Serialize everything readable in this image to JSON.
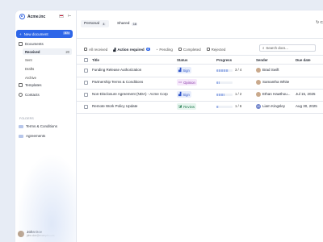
{
  "brand": {
    "name": "Acme.inc"
  },
  "sidebar": {
    "new_document": "New document",
    "new_document_kbd": "⌘N",
    "documents": "Documents",
    "sub": [
      {
        "label": "Received",
        "count": "20"
      },
      {
        "label": "Sent",
        "count": ""
      },
      {
        "label": "Drafts",
        "count": ""
      },
      {
        "label": "Archive",
        "count": ""
      }
    ],
    "templates": "Templates",
    "contacts": "Contacts",
    "folders_title": "FOLDERS",
    "folders": [
      "Terms & Conditions",
      "Agreements"
    ],
    "user_name": "John Doe",
    "user_email": "john.doe@example.com"
  },
  "top_tabs": [
    {
      "label": "Personal",
      "count": "4"
    },
    {
      "label": "Shared",
      "count": "18"
    }
  ],
  "sync_label": "C",
  "sub_tabs": [
    {
      "label": "All received",
      "count": ""
    },
    {
      "label": "Action required",
      "count": "4"
    },
    {
      "label": "Pending",
      "count": ""
    },
    {
      "label": "Completed",
      "count": ""
    },
    {
      "label": "Rejected",
      "count": ""
    }
  ],
  "search": {
    "placeholder": "Search docs..."
  },
  "table": {
    "columns": [
      "Title",
      "Status",
      "Progress",
      "Sender",
      "Due date"
    ],
    "rows": [
      {
        "title": "Funding Release Authorization",
        "status": "Sign",
        "progress_text": "3 / 4",
        "progress": 0.75,
        "sender": "Brad Swift",
        "avatar": "",
        "due": ""
      },
      {
        "title": "Partnership Terms & Conditions",
        "status": "Opinion",
        "progress_text": "",
        "progress": 0.2,
        "sender": "Samantha White",
        "avatar": "",
        "due": ""
      },
      {
        "title": "Non-Disclosure Agreement (NDA) - Acme Corp",
        "status": "Sign",
        "progress_text": "1 / 2",
        "progress": 0.5,
        "sender": "Ethan Hawthou...",
        "avatar": "",
        "due": "Jul 15, 2025"
      },
      {
        "title": "Remote Work Policy Update",
        "status": "Review",
        "progress_text": "1 / 6",
        "progress": 0.17,
        "sender": "Liam Kingsley",
        "avatar": "LK",
        "due": "Aug 30, 2025"
      }
    ]
  },
  "colors": {
    "accent": "#2e66e8",
    "sign": "#2e54c8",
    "opinion": "#8a3aa8",
    "review": "#227a4f"
  }
}
